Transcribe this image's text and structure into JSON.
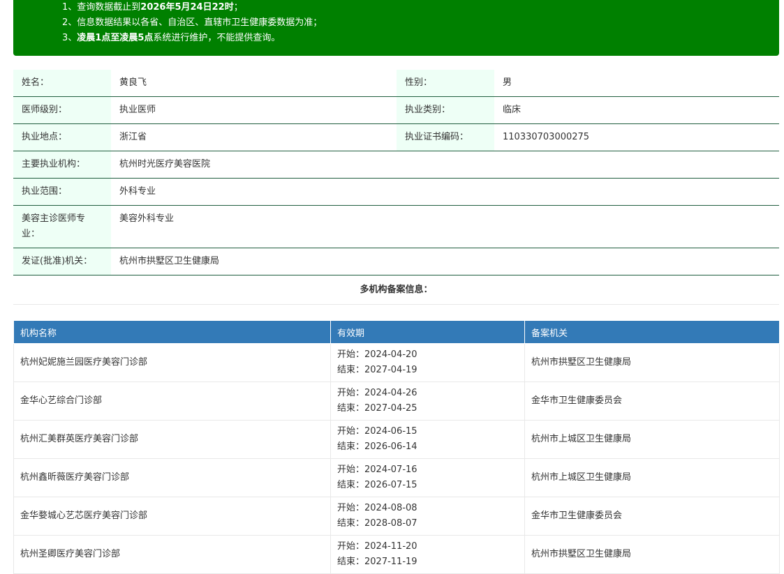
{
  "notice": {
    "line1_prefix": "1、查询数据截止到",
    "line1_bold": "2026年5月24日22时",
    "line1_suffix": "；",
    "line2": "2、信息数据结果以各省、自治区、直辖市卫生健康委数据为准；",
    "line3_prefix": "3、",
    "line3_bold": "凌晨1点至凌晨5点",
    "line3_suffix": "系统进行维护，不能提供查询。"
  },
  "info": {
    "name_label": "姓名：",
    "name": "黄良飞",
    "gender_label": "性别：",
    "gender": "男",
    "level_label": "医师级别：",
    "level": "执业医师",
    "category_label": "执业类别：",
    "category": "临床",
    "location_label": "执业地点：",
    "location": "浙江省",
    "cert_label": "执业证书编码：",
    "cert": "110330703000275",
    "org_label": "主要执业机构：",
    "org": "杭州时光医疗美容医院",
    "scope_label": "执业范围：",
    "scope": "外科专业",
    "cosmetic_label": "美容主诊医师专业：",
    "cosmetic": "美容外科专业",
    "issuer_label": "发证(批准)机关：",
    "issuer": "杭州市拱墅区卫生健康局"
  },
  "multi_title": "多机构备案信息：",
  "records": {
    "headers": [
      "机构名称",
      "有效期",
      "备案机关"
    ],
    "rows": [
      {
        "org": "杭州妃妮施兰园医疗美容门诊部",
        "start": "开始：2024-04-20",
        "end": "结束：2027-04-19",
        "authority": "杭州市拱墅区卫生健康局"
      },
      {
        "org": "金华心艺综合门诊部",
        "start": "开始：2024-04-26",
        "end": "结束：2027-04-25",
        "authority": "金华市卫生健康委员会"
      },
      {
        "org": "杭州汇美群英医疗美容门诊部",
        "start": "开始：2024-06-15",
        "end": "结束：2026-06-14",
        "authority": "杭州市上城区卫生健康局"
      },
      {
        "org": "杭州鑫昕薇医疗美容门诊部",
        "start": "开始：2024-07-16",
        "end": "结束：2026-07-15",
        "authority": "杭州市上城区卫生健康局"
      },
      {
        "org": "金华婺城心艺芯医疗美容门诊部",
        "start": "开始：2024-08-08",
        "end": "结束：2028-08-07",
        "authority": "金华市卫生健康委员会"
      },
      {
        "org": "杭州圣卿医疗美容门诊部",
        "start": "开始：2024-11-20",
        "end": "结束：2027-11-19",
        "authority": "杭州市拱墅区卫生健康局"
      }
    ]
  },
  "colors": {
    "notice_bg": "#008000",
    "header_bg": "#337ab7",
    "label_bg": "#eefff6"
  }
}
